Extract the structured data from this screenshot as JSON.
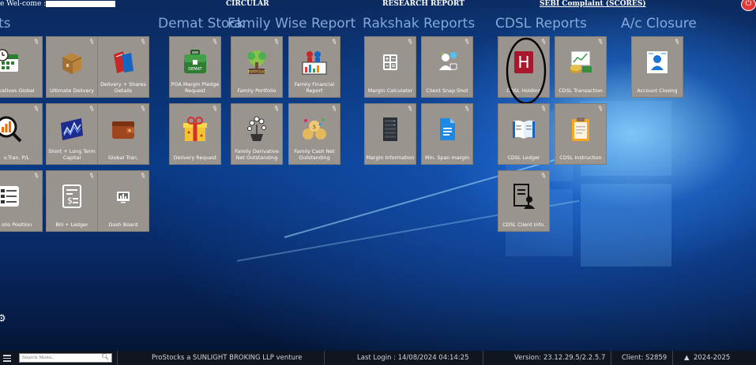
{
  "header": {
    "welcome": "e Wel-come :",
    "circular": "CIRCULAR",
    "research_report": "RESEARCH REPORT",
    "sebi_complaint": "SEBI Complaint (SCORES)"
  },
  "sections": {
    "reports_partial": "ts",
    "demat_stock": "Demat Stock",
    "family_wise": "Family Wise Report",
    "rakshak": "Rakshak Reports",
    "cdsl": "CDSL Reports",
    "ac_closure": "A/c Closure"
  },
  "tiles": {
    "derivatives_global": "vatives Global",
    "ultimate_delivery": "Ultimate Delivery",
    "delivery_shares_details": "Delivery + Shares Details",
    "inv_tran_pl": "v.Tran. P/L",
    "short_long_term_capital": "Short + Long Term Capital",
    "global_tran": "Global Tran.",
    "folio_position": "olio Position",
    "bill_ledger": "Bill + Ledger",
    "dash_board": "Dash Board",
    "poa_margin_pledge_request": "POA Margin Pledge Request",
    "delivery_request": "Delivery Request",
    "family_portfolio": "Family Portfolio",
    "family_derivative_net_outstanding": "Family Derivative Net Outstanding",
    "family_financial_report": "Family Financial Report",
    "family_cash_net_outstanding": "Family Cash Net Outstanding",
    "margin_calculator": "Margin Calculator",
    "margin_information": "Margin Information",
    "client_snap_shot": "Client Snap Shot",
    "min_span_margin": "Min. Span margin",
    "cdsl_holding": "CDSL Holding",
    "cdsl_ledger": "CDSL Ledger",
    "cdsl_client_info": "CDSL Client Info.",
    "cdsl_transaction": "CDSL Transaction",
    "cdsl_instruction": "CDSL Instruction",
    "account_closing": "Account Closing",
    "demat_badge": "DEMAT",
    "portfolio_badge": "PORTFOLIO"
  },
  "taskbar": {
    "search_placeholder": "Search Menu..",
    "venture": "ProStocks a SUNLIGHT BROKING LLP venture",
    "last_login": "Last Login : 14/08/2024 04:14:25",
    "version": "Version: 23.12.29.5/2.2.5.7",
    "client": "Client: S2859",
    "year": "2024-2025"
  },
  "colors": {
    "tile_bg": "#9a948f",
    "accent_red": "#e53935",
    "taskbar_bg": "#101620"
  }
}
